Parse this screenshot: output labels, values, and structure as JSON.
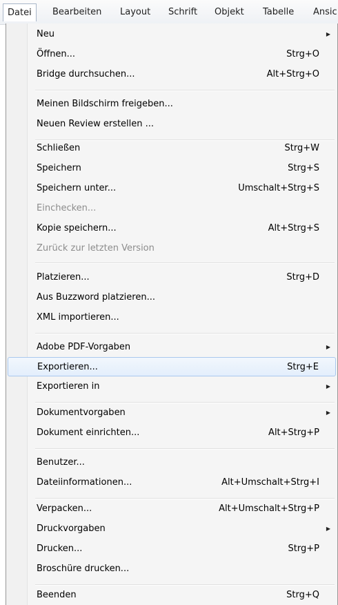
{
  "menubar": {
    "items": [
      {
        "label": "Datei"
      },
      {
        "label": "Bearbeiten"
      },
      {
        "label": "Layout"
      },
      {
        "label": "Schrift"
      },
      {
        "label": "Objekt"
      },
      {
        "label": "Tabelle"
      },
      {
        "label": "Ansic"
      }
    ]
  },
  "menu": {
    "items": [
      {
        "label": "Neu",
        "shortcut": "",
        "submenu": true
      },
      {
        "label": "Öffnen...",
        "shortcut": "Strg+O"
      },
      {
        "label": "Bridge durchsuchen...",
        "shortcut": "Alt+Strg+O"
      },
      {
        "label": "Meinen Bildschirm freigeben...",
        "shortcut": ""
      },
      {
        "label": "Neuen Review erstellen ...",
        "shortcut": ""
      },
      {
        "label": "Schließen",
        "shortcut": "Strg+W"
      },
      {
        "label": "Speichern",
        "shortcut": "Strg+S"
      },
      {
        "label": "Speichern unter...",
        "shortcut": "Umschalt+Strg+S"
      },
      {
        "label": "Einchecken...",
        "shortcut": "",
        "disabled": true
      },
      {
        "label": "Kopie speichern...",
        "shortcut": "Alt+Strg+S"
      },
      {
        "label": "Zurück zur letzten Version",
        "shortcut": "",
        "disabled": true
      },
      {
        "label": "Platzieren...",
        "shortcut": "Strg+D"
      },
      {
        "label": "Aus Buzzword platzieren...",
        "shortcut": ""
      },
      {
        "label": "XML importieren...",
        "shortcut": ""
      },
      {
        "label": "Adobe PDF-Vorgaben",
        "shortcut": "",
        "submenu": true
      },
      {
        "label": "Exportieren...",
        "shortcut": "Strg+E",
        "highlighted": true
      },
      {
        "label": "Exportieren in",
        "shortcut": "",
        "submenu": true
      },
      {
        "label": "Dokumentvorgaben",
        "shortcut": "",
        "submenu": true
      },
      {
        "label": "Dokument einrichten...",
        "shortcut": "Alt+Strg+P"
      },
      {
        "label": "Benutzer...",
        "shortcut": ""
      },
      {
        "label": "Dateiinformationen...",
        "shortcut": "Alt+Umschalt+Strg+I"
      },
      {
        "label": "Verpacken...",
        "shortcut": "Alt+Umschalt+Strg+P"
      },
      {
        "label": "Druckvorgaben",
        "shortcut": "",
        "submenu": true
      },
      {
        "label": "Drucken...",
        "shortcut": "Strg+P"
      },
      {
        "label": "Broschüre drucken...",
        "shortcut": ""
      },
      {
        "label": "Beenden",
        "shortcut": "Strg+Q"
      }
    ],
    "submenu_arrow": "▶"
  }
}
